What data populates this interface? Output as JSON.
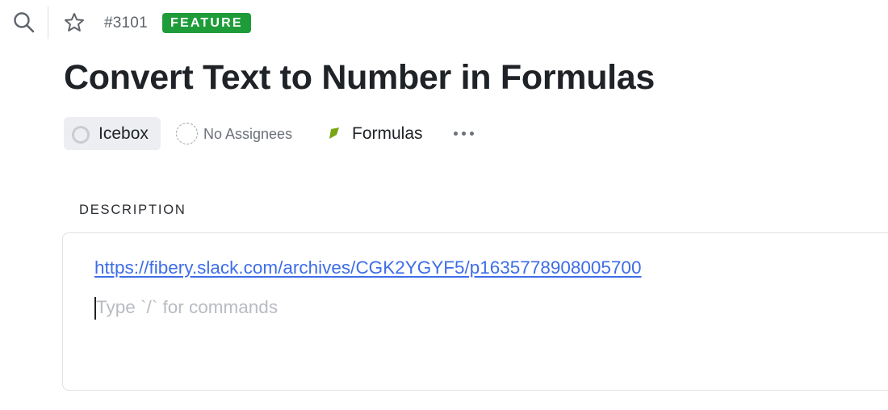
{
  "header": {
    "issue_id": "#3101",
    "type_badge": "FEATURE",
    "type_badge_color": "#1f9c3a"
  },
  "title": "Convert Text to Number in Formulas",
  "meta": {
    "state": "Icebox",
    "assignees": "No Assignees",
    "module": "Formulas",
    "module_color": "#7aa615"
  },
  "description": {
    "label": "DESCRIPTION",
    "link": "https://fibery.slack.com/archives/CGK2YGYF5/p1635778908005700",
    "placeholder": "Type `/` for commands"
  },
  "icons": {
    "search": "search-icon",
    "star": "star-icon",
    "state": "circle-status-icon",
    "assignee": "dashed-avatar-icon",
    "module": "module-flag-icon",
    "more": "more-horizontal-icon"
  },
  "colors": {
    "link": "#3d6de8",
    "placeholder": "#b8bcc2"
  }
}
